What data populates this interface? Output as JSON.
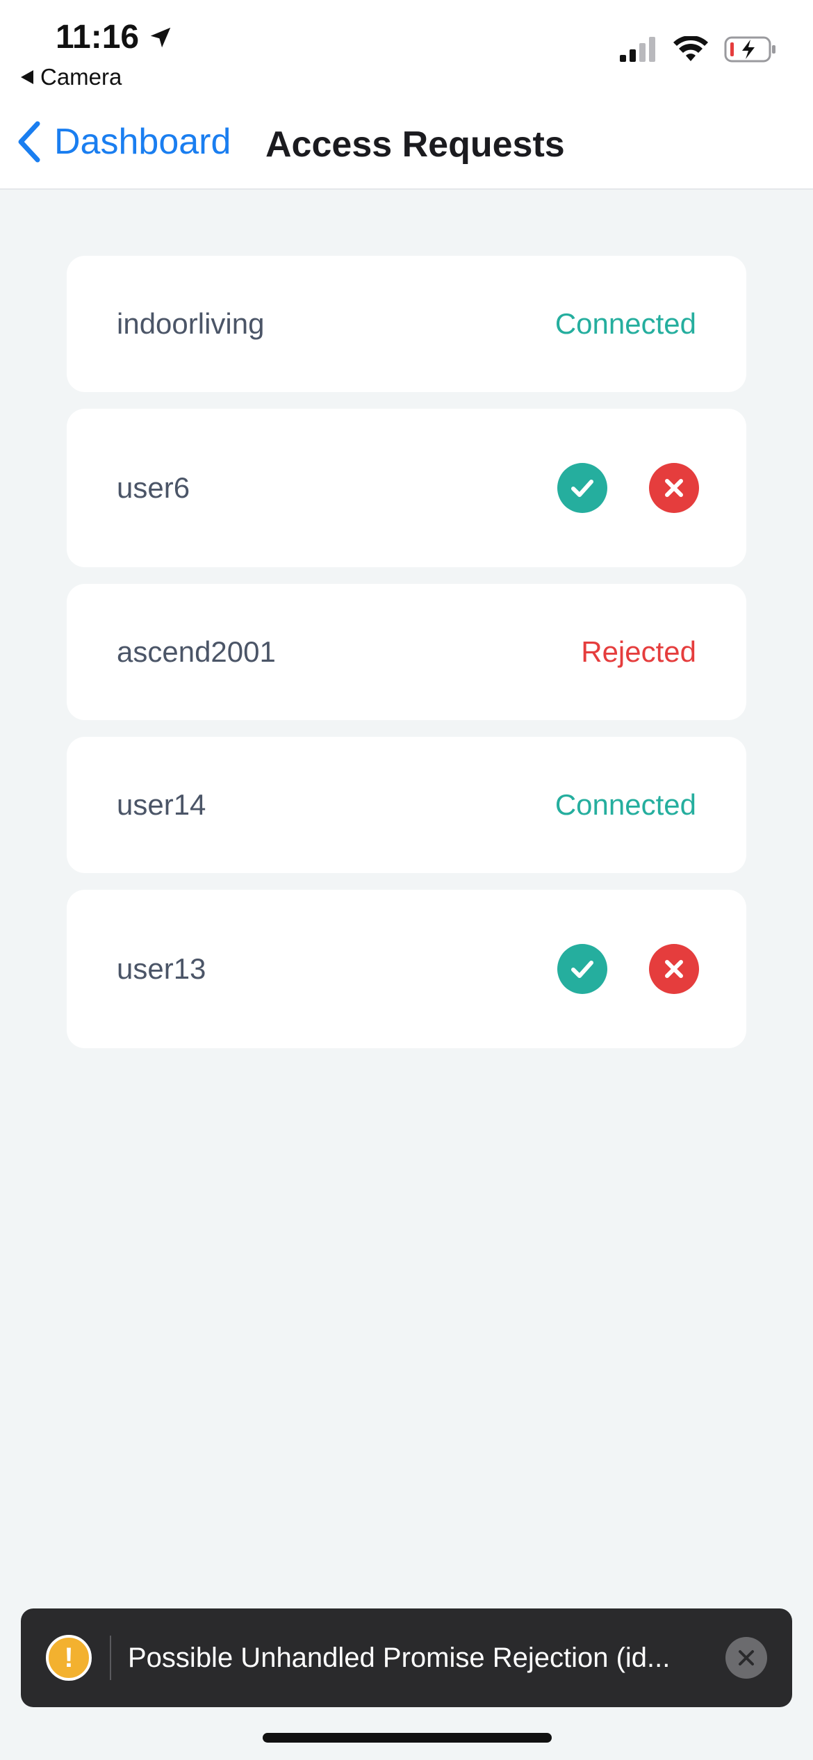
{
  "status_bar": {
    "time": "11:16",
    "back_app": "Camera"
  },
  "nav": {
    "back_label": "Dashboard",
    "title": "Access Requests"
  },
  "colors": {
    "connected": "#25ae9e",
    "rejected": "#e53d3d",
    "approve": "#25ae9e",
    "reject": "#e53d3d",
    "link": "#1a7ef0"
  },
  "requests": [
    {
      "username": "indoorliving",
      "status": "Connected"
    },
    {
      "username": "user6",
      "status": ""
    },
    {
      "username": "ascend2001",
      "status": "Rejected"
    },
    {
      "username": "user14",
      "status": "Connected"
    },
    {
      "username": "user13",
      "status": ""
    }
  ],
  "toast": {
    "message": "Possible Unhandled Promise Rejection (id..."
  }
}
